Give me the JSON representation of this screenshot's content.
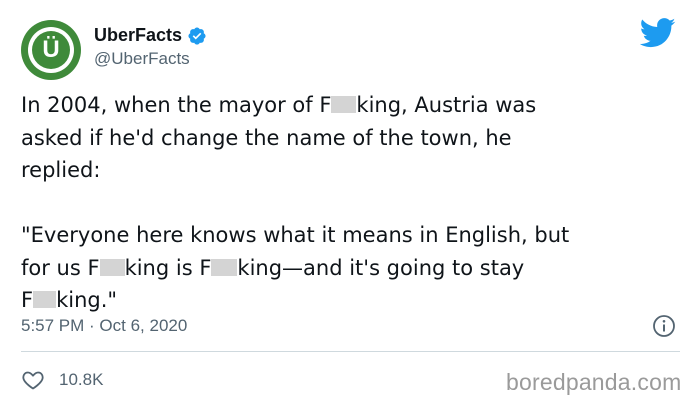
{
  "account": {
    "display_name": "UberFacts",
    "handle": "@UberFacts",
    "avatar_letter": "Ü",
    "verified": true,
    "avatar_color": "#3f8a3a"
  },
  "tweet": {
    "line1_a": "In 2004, when the mayor of F",
    "line1_b": "king, Austria was",
    "line2": "asked if he'd change the name of the town, he",
    "line3": "replied:",
    "quote_line1": "\"Everyone here knows what it means in English, but",
    "quote_line2_a": "for us F",
    "quote_line2_b": "king is F",
    "quote_line2_c": "king—and it's going to stay",
    "quote_line3_a": "F",
    "quote_line3_b": "king.\""
  },
  "meta": {
    "timestamp": "5:57 PM · Oct 6, 2020"
  },
  "actions": {
    "like_count": "10.8K"
  },
  "watermark": "boredpanda.com",
  "colors": {
    "twitter_blue": "#1d9bf0",
    "secondary_text": "#536471",
    "censor_gray": "#d4d4d4"
  },
  "icons": {
    "brand": "twitter-bird-icon",
    "verified": "verified-badge-icon",
    "info": "info-icon",
    "like": "heart-icon"
  }
}
